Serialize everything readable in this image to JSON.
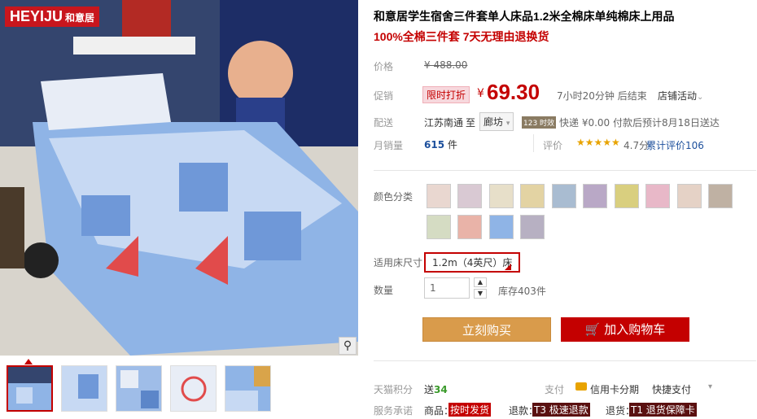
{
  "brand": {
    "name": "HEYIJU",
    "cn": "和意居"
  },
  "product": {
    "title": "和意居学生宿舍三件套单人床品1.2米全棉床单纯棉床上用品",
    "subtitle": "100%全棉三件套 7天无理由退换货"
  },
  "price": {
    "label": "价格",
    "original": "¥ 488.00",
    "promo_label": "促销",
    "promo_badge": "限时打折",
    "symbol": "¥",
    "current": "69.30",
    "countdown": "7小时20分钟 后结束",
    "store_activity": "店铺活动"
  },
  "shipping": {
    "label": "配送",
    "from": "江苏南通",
    "to_word": "至",
    "to": "廊坊",
    "badge": "123 时效",
    "method": "快递 ¥0.00 付款后预计8月18日送达"
  },
  "sales": {
    "label": "月销量",
    "count": "615",
    "unit": "件",
    "rating_label": "评价",
    "rating_value": "4.7分",
    "rating_text": "累计评价106"
  },
  "options": {
    "color_label": "颜色分类",
    "size_label": "适用床尺寸",
    "size_selected": "1.2m（4英尺）床",
    "qty_label": "数量",
    "qty_value": "1",
    "stock": "库存403件"
  },
  "actions": {
    "buy": "立刻购买",
    "cart": "加入购物车"
  },
  "footer": {
    "points_label": "天猫积分",
    "points": "送34",
    "pay_label": "支付",
    "pay_credit": "信用卡分期",
    "pay_fast": "快捷支付",
    "service_label": "服务承诺",
    "goods_label": "商品：",
    "goods_tag": "按时发货",
    "refund_label": "退款：",
    "refund_tag": "T3 极速退款",
    "return_label": "退货：",
    "return_tag": "T1 退货保障卡"
  },
  "colors": {
    "accent": "#c40000",
    "buy": "#d99b4b"
  }
}
